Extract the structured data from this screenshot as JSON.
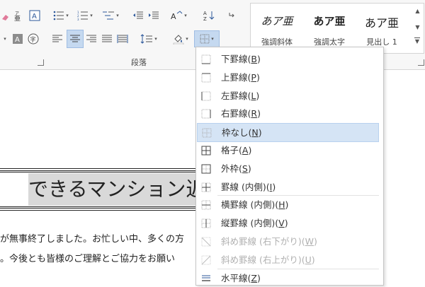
{
  "ribbon": {
    "group_label": "段落",
    "styles": [
      {
        "preview": "あア亜",
        "name": "強調斜体"
      },
      {
        "preview": "あア亜",
        "name": "強調太字"
      },
      {
        "preview": "あア亜",
        "name": "見出し 1"
      }
    ]
  },
  "document": {
    "heading": "できるマンション",
    "heading_tail": "近",
    "line1": "が無事終了しました。お忙しい中、多くの方",
    "line2": "。今後とも皆様のご理解とご協力をお願い"
  },
  "border_menu": {
    "items": [
      {
        "label": "下罫線",
        "key": "B",
        "icon": "border-bottom-icon",
        "state": "normal"
      },
      {
        "label": "上罫線",
        "key": "P",
        "icon": "border-top-icon",
        "state": "normal"
      },
      {
        "label": "左罫線",
        "key": "L",
        "icon": "border-left-icon",
        "state": "normal"
      },
      {
        "label": "右罫線",
        "key": "R",
        "icon": "border-right-icon",
        "state": "normal"
      },
      {
        "label": "枠なし",
        "key": "N",
        "icon": "no-border-icon",
        "state": "highlighted"
      },
      {
        "label": "格子",
        "key": "A",
        "icon": "all-borders-icon",
        "state": "normal"
      },
      {
        "label": "外枠",
        "key": "S",
        "icon": "outside-borders-icon",
        "state": "normal"
      },
      {
        "label": "罫線 (内側)",
        "key": "I",
        "icon": "inside-borders-icon",
        "state": "normal"
      },
      {
        "label": "横罫線 (内側)",
        "key": "H",
        "icon": "inside-horizontal-border-icon",
        "state": "normal"
      },
      {
        "label": "縦罫線 (内側)",
        "key": "V",
        "icon": "inside-vertical-border-icon",
        "state": "normal"
      },
      {
        "label": "斜め罫線 (右下がり)",
        "key": "W",
        "icon": "diagonal-down-border-icon",
        "state": "disabled"
      },
      {
        "label": "斜め罫線 (右上がり)",
        "key": "U",
        "icon": "diagonal-up-border-icon",
        "state": "disabled"
      },
      {
        "label": "水平線",
        "key": "Z",
        "icon": "horizontal-line-icon",
        "state": "normal"
      }
    ]
  },
  "colors": {
    "highlight": "#d5e4f5",
    "heading_shade": "#d9d9d9",
    "accent_blue": "#2b579a"
  }
}
